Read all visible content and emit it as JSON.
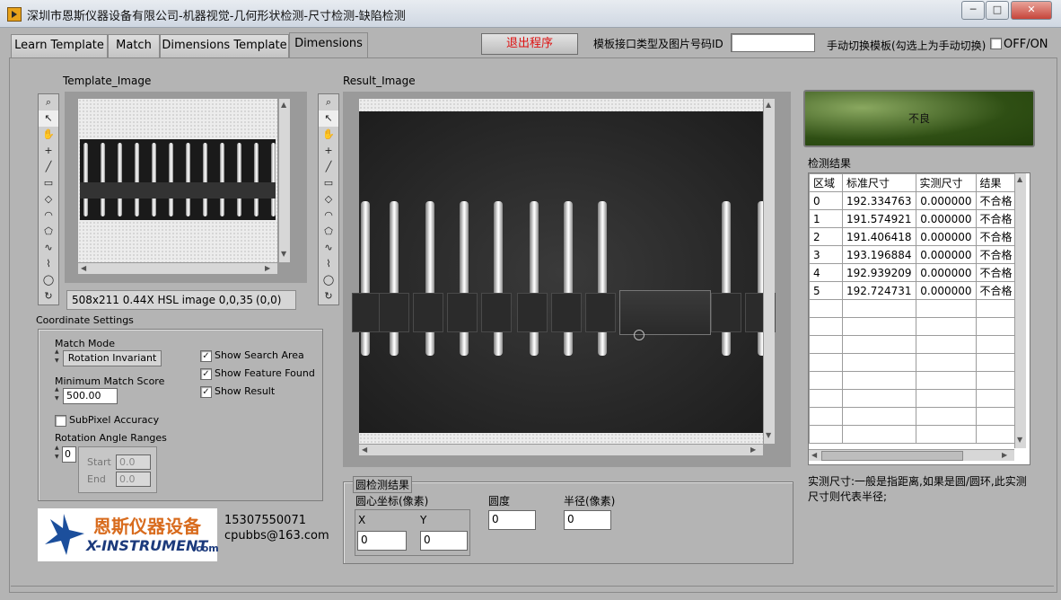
{
  "window": {
    "title": "深圳市恩斯仪器设备有限公司-机器视觉-几何形状检测-尺寸检测-缺陷检测",
    "minimize_icon": "minimize-icon",
    "maximize_icon": "maximize-icon",
    "close_icon": "close-icon"
  },
  "tabs": [
    {
      "label": "Learn Template"
    },
    {
      "label": "Match"
    },
    {
      "label": "Dimensions Template"
    },
    {
      "label": "Dimensions",
      "active": true
    }
  ],
  "header": {
    "exit_button": "退出程序",
    "template_id_label": "模板接口类型及图片号码ID",
    "template_id_value": "",
    "manual_switch_label": "手动切换模板(勾选上为手动切换)",
    "off_on_label": "OFF/ON",
    "off_on_checked": false
  },
  "template_image": {
    "title": "Template_Image",
    "status": "508x211 0.44X HSL image 0,0,35",
    "coords": "(0,0)"
  },
  "result_image": {
    "title": "Result_Image"
  },
  "tools": [
    "zoom-icon",
    "pointer-icon",
    "pan-icon",
    "crosshair-icon",
    "line-icon",
    "rectangle-icon",
    "rotated-rectangle-icon",
    "annulus-icon",
    "polygon-icon",
    "freehand-icon",
    "broken-line-icon",
    "oval-icon",
    "rotate-icon"
  ],
  "coordinate_settings": {
    "title": "Coordinate Settings",
    "match_mode_label": "Match Mode",
    "match_mode_value": "Rotation Invariant",
    "min_score_label": "Minimum Match Score",
    "min_score_value": "500.00",
    "subpixel_label": "SubPixel Accuracy",
    "subpixel_checked": false,
    "rotation_label": "Rotation Angle Ranges",
    "rotation_index": "0",
    "start_label": "Start",
    "start_value": "0.0",
    "end_label": "End",
    "end_value": "0.0",
    "show_search_area": "Show Search Area",
    "show_feature_found": "Show Feature Found",
    "show_result": "Show Result"
  },
  "company": {
    "logo_cn": "恩斯仪器设备",
    "logo_en": "X-INSTRUMENT",
    "logo_suffix": ".com",
    "phone": "15307550071",
    "email": "cpubbs@163.com"
  },
  "status_indicator": {
    "text": "不良",
    "color": "#2f4f14"
  },
  "results": {
    "title": "检测结果",
    "columns": [
      "区域",
      "标准尺寸",
      "实测尺寸",
      "结果"
    ],
    "rows": [
      [
        "0",
        "192.334763",
        "0.000000",
        "不合格"
      ],
      [
        "1",
        "191.574921",
        "0.000000",
        "不合格"
      ],
      [
        "2",
        "191.406418",
        "0.000000",
        "不合格"
      ],
      [
        "3",
        "193.196884",
        "0.000000",
        "不合格"
      ],
      [
        "4",
        "192.939209",
        "0.000000",
        "不合格"
      ],
      [
        "5",
        "192.724731",
        "0.000000",
        "不合格"
      ]
    ],
    "note": "实测尺寸:一般是指距离,如果是圆/圆环,此实测尺寸则代表半径;"
  },
  "circle_detection": {
    "title": "圆检测结果",
    "center_label": "圆心坐标(像素)",
    "x_label": "X",
    "y_label": "Y",
    "x_value": "0",
    "y_value": "0",
    "roundness_label": "圆度",
    "roundness_value": "0",
    "radius_label": "半径(像素)",
    "radius_value": "0"
  }
}
